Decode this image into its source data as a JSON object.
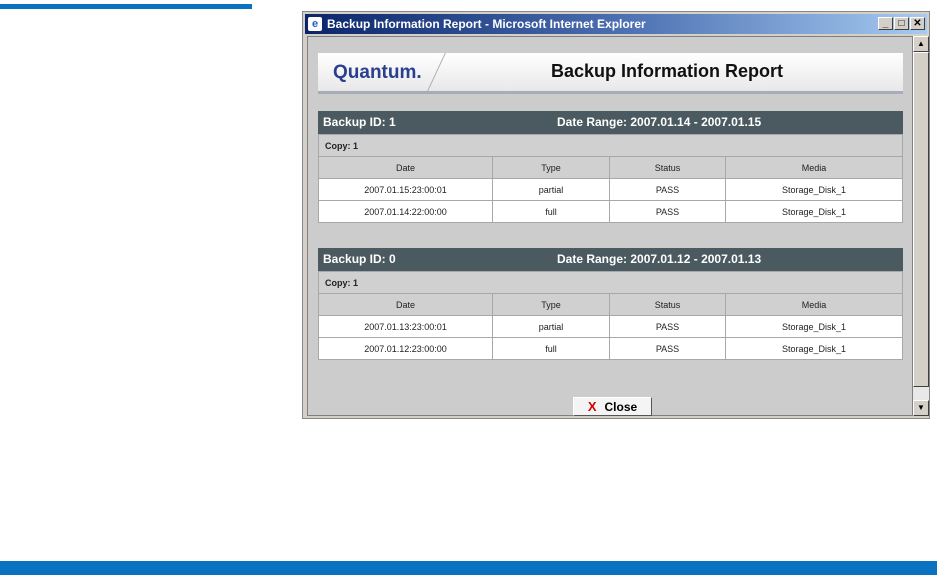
{
  "window": {
    "title": "Backup Information Report - Microsoft Internet Explorer",
    "minimize": "_",
    "maximize": "□",
    "close": "✕"
  },
  "banner": {
    "logo": "Quantum.",
    "title": "Backup Information Report"
  },
  "columns": [
    "Date",
    "Type",
    "Status",
    "Media"
  ],
  "sections": [
    {
      "id_label": "Backup ID: 1",
      "range_label": "Date Range:  2007.01.14 - 2007.01.15",
      "copy": "Copy: 1",
      "rows": [
        [
          "2007.01.15:23:00:01",
          "partial",
          "PASS",
          "Storage_Disk_1"
        ],
        [
          "2007.01.14:22:00:00",
          "full",
          "PASS",
          "Storage_Disk_1"
        ]
      ]
    },
    {
      "id_label": "Backup ID: 0",
      "range_label": "Date Range:  2007.01.12 - 2007.01.13",
      "copy": "Copy: 1",
      "rows": [
        [
          "2007.01.13:23:00:01",
          "partial",
          "PASS",
          "Storage_Disk_1"
        ],
        [
          "2007.01.12:23:00:00",
          "full",
          "PASS",
          "Storage_Disk_1"
        ]
      ]
    }
  ],
  "close_button": {
    "icon": "X",
    "label": "Close"
  }
}
